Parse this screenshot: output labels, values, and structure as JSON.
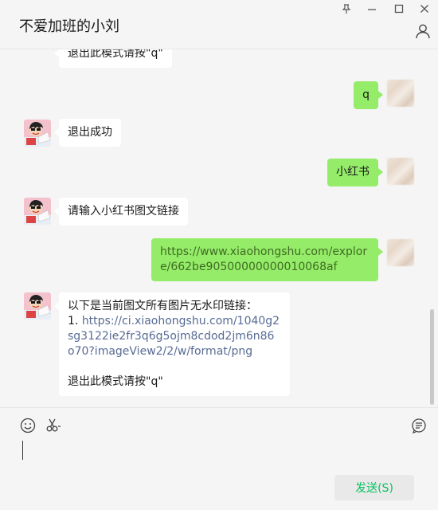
{
  "window": {
    "title": "不爱加班的小刘",
    "pin_icon": "pin-icon",
    "minimize_icon": "minimize-icon",
    "maximize_icon": "maximize-icon",
    "close_icon": "close-icon",
    "profile_icon": "person-icon"
  },
  "messages": [
    {
      "side": "left",
      "text": "退出此模式请按\"q\""
    },
    {
      "side": "right",
      "text": "q"
    },
    {
      "side": "left",
      "text": "退出成功"
    },
    {
      "side": "right",
      "text": "小红书"
    },
    {
      "side": "left",
      "text": "请输入小红书图文链接"
    },
    {
      "side": "right",
      "text": "https://www.xiaohongshu.com/explore/662be90500000000010068af"
    },
    {
      "side": "left",
      "intro": "以下是当前图文所有图片无水印链接：",
      "item_number": "1.",
      "link": "https://ci.xiaohongshu.com/1040g2sg3122ie2fr3q6g5ojm8cdod2jm6n86o70?imageView2/2/w/format/png",
      "footer": "退出此模式请按\"q\""
    }
  ],
  "toolbar": {
    "emoji_icon": "emoji-icon",
    "scissors_icon": "scissors-icon",
    "chat_history_icon": "chat-history-icon"
  },
  "send_button": {
    "label": "发送(S)"
  },
  "colors": {
    "bubble_self": "#95ec69",
    "bubble_other": "#ffffff",
    "background": "#f5f5f5",
    "link": "#576b95",
    "send_text": "#07c160"
  }
}
